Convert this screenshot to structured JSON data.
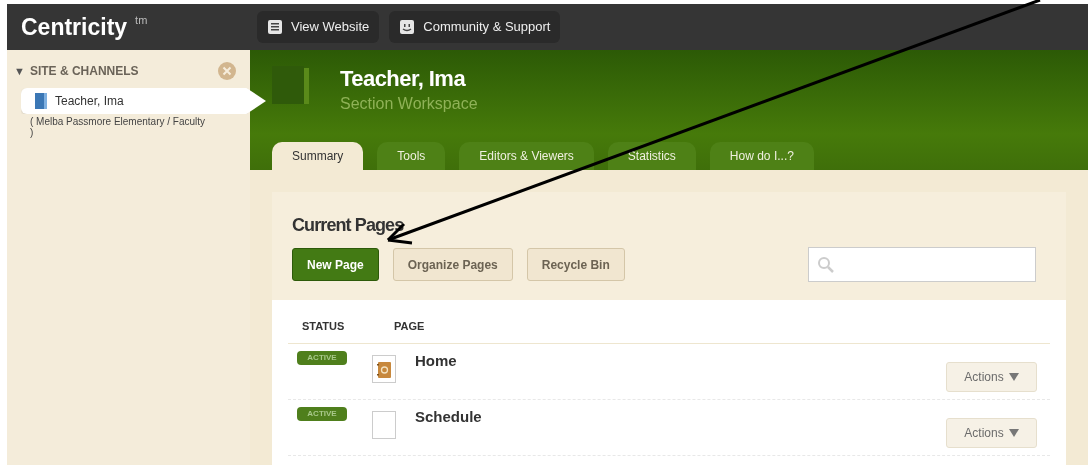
{
  "topbar": {
    "logo": "Centricity",
    "logo_mark": "tm",
    "links": [
      {
        "label": "View Website",
        "kind": "page"
      },
      {
        "label": "Community & Support",
        "kind": "smiley"
      }
    ]
  },
  "sidebar": {
    "toggle": "▼",
    "title": "SITE & CHANNELS",
    "expanded": true,
    "items": [
      {
        "label": "Teacher, Ima",
        "selected": true,
        "path": "( Melba Passmore Elementary / Faculty )"
      }
    ]
  },
  "header": {
    "title": "Teacher, Ima",
    "subtitle": "Section Workspace"
  },
  "tabs": [
    {
      "label": "Summary",
      "selected": true
    },
    {
      "label": "Tools",
      "selected": false
    },
    {
      "label": "Editors & Viewers",
      "selected": false
    },
    {
      "label": "Statistics",
      "selected": false
    },
    {
      "label": "How do I...?",
      "selected": false
    }
  ],
  "current_pages": {
    "heading": "Current Pages",
    "buttons": [
      {
        "label": "New Page",
        "primary": true
      },
      {
        "label": "Organize Pages",
        "primary": false
      },
      {
        "label": "Recycle Bin",
        "primary": false
      }
    ],
    "table": {
      "columns": [
        "STATUS",
        "PAGE"
      ],
      "rows": [
        {
          "status": "ACTIVE",
          "page": "Home",
          "kind": "notebook",
          "action": "Actions"
        },
        {
          "status": "ACTIVE",
          "page": "Schedule",
          "kind": "blank",
          "action": "Actions"
        }
      ]
    }
  }
}
